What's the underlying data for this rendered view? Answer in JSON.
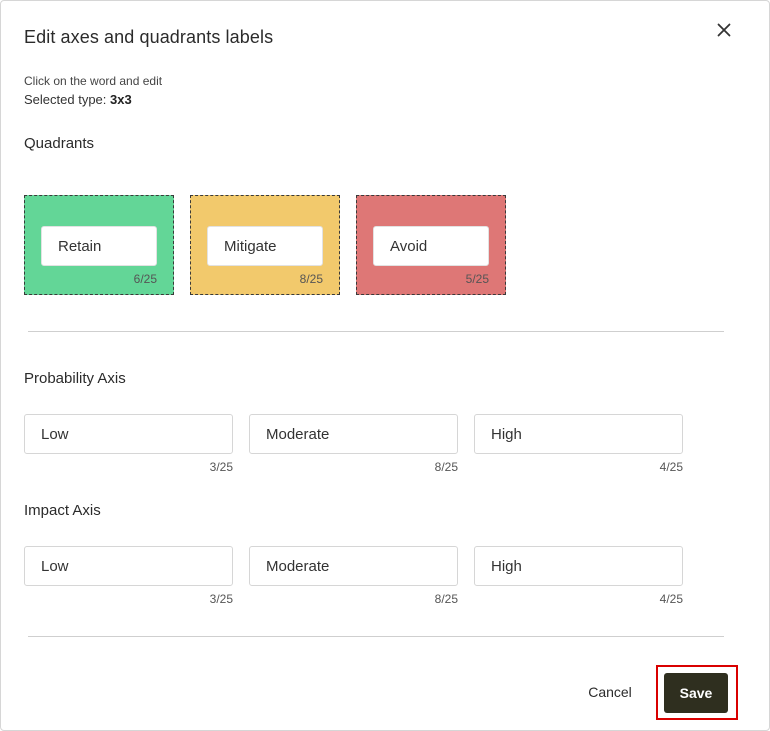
{
  "dialog": {
    "title": "Edit axes and quadrants labels",
    "close_icon": "close-icon",
    "hint": "Click on the word and edit",
    "selected_type_label": "Selected type:",
    "selected_type_value": "3x3"
  },
  "quadrants": {
    "heading": "Quadrants",
    "items": [
      {
        "value": "Retain",
        "count": "6/25",
        "color": "#63d697"
      },
      {
        "value": "Mitigate",
        "count": "8/25",
        "color": "#f2c96c"
      },
      {
        "value": "Avoid",
        "count": "5/25",
        "color": "#de7776"
      }
    ]
  },
  "probability_axis": {
    "heading": "Probability Axis",
    "items": [
      {
        "value": "Low",
        "count": "3/25"
      },
      {
        "value": "Moderate",
        "count": "8/25"
      },
      {
        "value": "High",
        "count": "4/25"
      }
    ]
  },
  "impact_axis": {
    "heading": "Impact Axis",
    "items": [
      {
        "value": "Low",
        "count": "3/25"
      },
      {
        "value": "Moderate",
        "count": "8/25"
      },
      {
        "value": "High",
        "count": "4/25"
      }
    ]
  },
  "footer": {
    "cancel_label": "Cancel",
    "save_label": "Save",
    "save_color": "#2f2f1f",
    "highlight_color": "#d90000"
  }
}
